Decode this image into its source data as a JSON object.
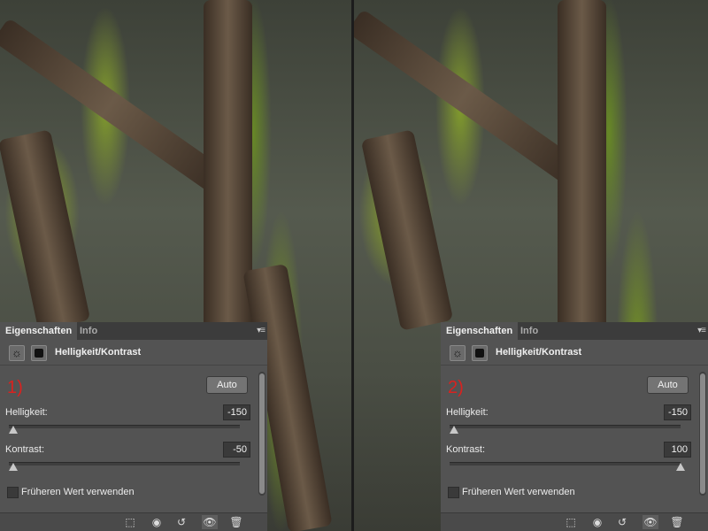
{
  "panels": [
    {
      "tabs": {
        "active": "Eigenschaften",
        "inactive": "Info"
      },
      "header_title": "Helligkeit/Kontrast",
      "step_label": "1)",
      "auto_label": "Auto",
      "brightness": {
        "label": "Helligkeit:",
        "value": "-150",
        "position": 0.0
      },
      "contrast": {
        "label": "Kontrast:",
        "value": "-50",
        "position": 0.0
      },
      "legacy_label": "Früheren Wert verwenden"
    },
    {
      "tabs": {
        "active": "Eigenschaften",
        "inactive": "Info"
      },
      "header_title": "Helligkeit/Kontrast",
      "step_label": "2)",
      "auto_label": "Auto",
      "brightness": {
        "label": "Helligkeit:",
        "value": "-150",
        "position": 0.0
      },
      "contrast": {
        "label": "Kontrast:",
        "value": "100",
        "position": 1.0
      },
      "legacy_label": "Früheren Wert verwenden"
    }
  ],
  "icons": {
    "sun": "brightness-contrast-icon",
    "mask": "layer-mask-icon",
    "footer": [
      "clip-to-layer-icon",
      "view-previous-state-icon",
      "reset-icon",
      "visibility-eye-icon",
      "delete-trash-icon"
    ]
  },
  "colors": {
    "step_label": "#d9221f",
    "panel_bg": "#535353"
  }
}
